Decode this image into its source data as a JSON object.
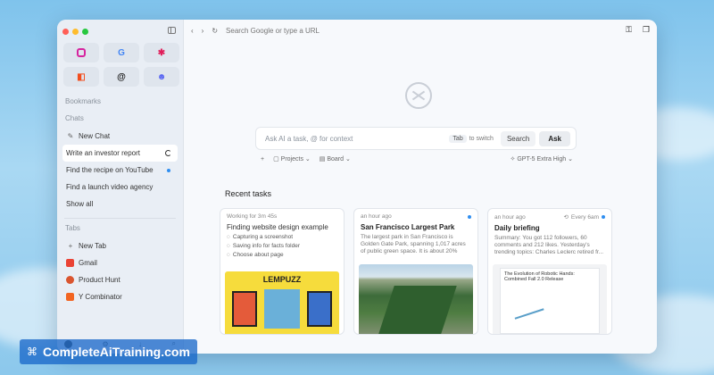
{
  "sidebar": {
    "bookmarks_label": "Bookmarks",
    "chats_label": "Chats",
    "new_chat": "New Chat",
    "chats": [
      {
        "label": "Write an investor report"
      },
      {
        "label": "Find the recipe on YouTube"
      },
      {
        "label": "Find a launch video agency"
      }
    ],
    "show_all": "Show all",
    "tabs_label": "Tabs",
    "new_tab": "New Tab",
    "tabs": [
      {
        "label": "Gmail",
        "color": "#ea4335"
      },
      {
        "label": "Product Hunt",
        "color": "#da552f"
      },
      {
        "label": "Y Combinator",
        "color": "#f26522"
      }
    ]
  },
  "topbar": {
    "url_placeholder": "Search Google or type a URL"
  },
  "search": {
    "placeholder": "Ask AI a task, @ for context",
    "tab_key": "Tab",
    "tab_hint": "to switch",
    "search_label": "Search",
    "ask_label": "Ask"
  },
  "below_search": {
    "plus": "+",
    "projects": "Projects",
    "board": "Board",
    "model": "GPT-5 Extra High"
  },
  "recent": {
    "title": "Recent tasks",
    "cards": [
      {
        "meta": "Working for 3m 45s",
        "title": "Finding website design example",
        "steps": [
          "Capturing a screenshot",
          "Saving info for facts folder",
          "Choose about page"
        ],
        "thumb_caption": "LEMPUZZ"
      },
      {
        "meta": "an hour ago",
        "title": "San Francisco Largest Park",
        "desc": "The largest park in San Francisco is Golden Gate Park, spanning 1,017 acres of public green space. It is about 20% larger..."
      },
      {
        "meta": "an hour ago",
        "meta_right": "Every 6am",
        "title": "Daily briefing",
        "desc": "Summary: You got 112 followers, 60 comments and 212 likes. Yesterday's trending topics: Charles Leclerc retired fr...",
        "thumb_caption": "The Evolution of Robotic Hands: Combined Fall 2.0 Release"
      }
    ]
  },
  "watermark": "CompleteAiTraining.com"
}
